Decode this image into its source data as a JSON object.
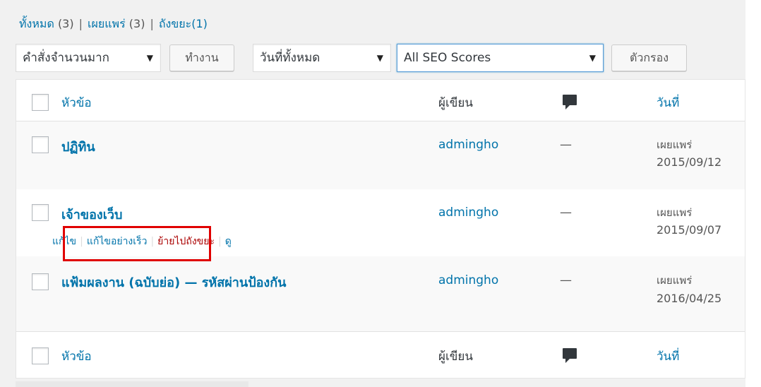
{
  "filters": {
    "all_label": "ทั้งหมด",
    "all_count": "(3)",
    "published_label": "เผยแพร่",
    "published_count": "(3)",
    "trash_label": "ถังขยะ",
    "trash_count": "(1)",
    "separator": "|"
  },
  "toolbar": {
    "bulk_actions": "คำสั่งจำนวนมาก",
    "apply_button": "ทำงาน",
    "date_filter": "วันที่ทั้งหมด",
    "seo_filter": "All SEO Scores",
    "filter_button": "ตัวกรอง",
    "dropdown_arrow": "▼"
  },
  "table": {
    "header": {
      "title": "หัวข้อ",
      "author": "ผู้เขียน",
      "date": "วันที่"
    },
    "footer": {
      "title": "หัวข้อ",
      "author": "ผู้เขียน",
      "date": "วันที่"
    },
    "rows": [
      {
        "title": "ปฏิทิน",
        "author": "admingho",
        "comments": "—",
        "status": "เผยแพร่",
        "date": "2015/09/12"
      },
      {
        "title": "เจ้าของเว็บ",
        "author": "admingho",
        "comments": "—",
        "status": "เผยแพร่",
        "date": "2015/09/07"
      },
      {
        "title": "แฟ้มผลงาน (ฉบับย่อ) — รหัสผ่านป้องกัน",
        "author": "admingho",
        "comments": "—",
        "status": "เผยแพร่",
        "date": "2016/04/25"
      }
    ],
    "row_actions": {
      "edit": "แก้ไข",
      "quick_edit": "แก้ไขอย่างเร็ว",
      "trash": "ย้ายไปถังขยะ",
      "view": "ดู",
      "separator": "|"
    }
  },
  "icons": {
    "comment": "comment-bubble-icon",
    "dropdown": "chevron-down-icon"
  },
  "colors": {
    "link": "#0073aa",
    "trash": "#aa0000",
    "highlight": "#e00000"
  }
}
